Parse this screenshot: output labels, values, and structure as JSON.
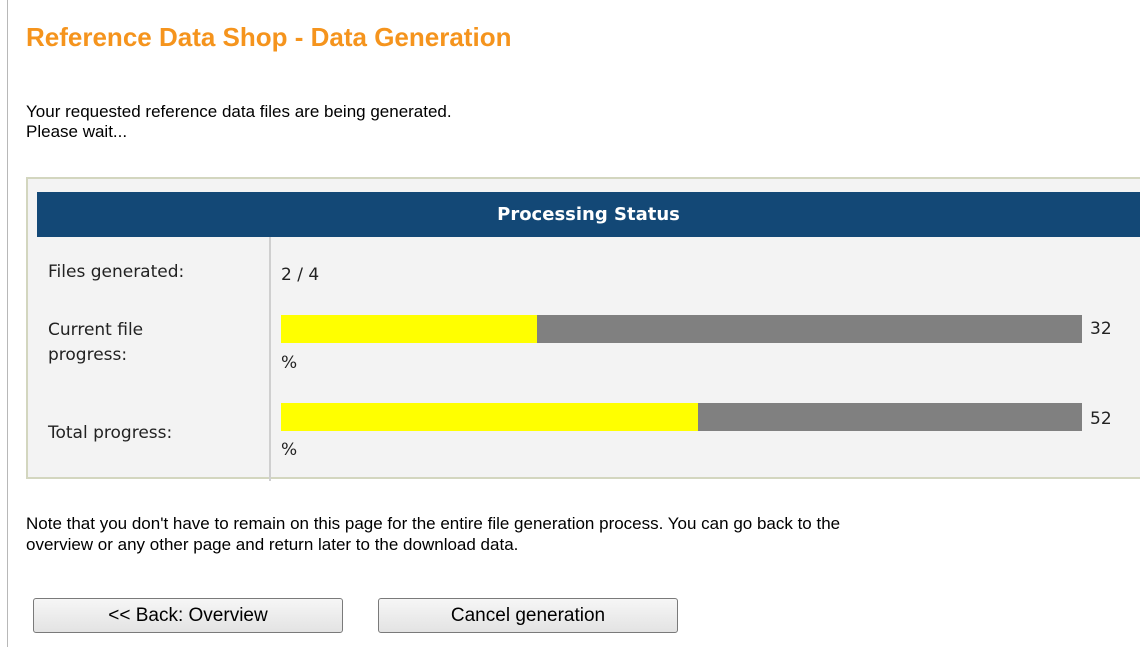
{
  "page": {
    "title": "Reference Data Shop - Data Generation",
    "intro_line1": "Your requested reference data files are being generated.",
    "intro_line2": "Please wait..."
  },
  "status": {
    "header": "Processing Status",
    "files_generated_label": "Files generated:",
    "files_generated_value": "2 / 4",
    "current_file_label_line1": "Current file",
    "current_file_label_line2": "progress:",
    "current_file_percent": "32",
    "current_file_fraction": 0.32,
    "total_label": "Total progress:",
    "total_percent": "52",
    "total_fraction": 0.52,
    "percent_unit": "%"
  },
  "note": {
    "line1": "Note that you don't have to remain on this page for the entire file generation process. You can go back to the",
    "line2": "overview or any other page and return later to the download data."
  },
  "buttons": {
    "back_label": "<< Back: Overview",
    "cancel_label": "Cancel generation"
  },
  "colors": {
    "title": "#f5941d",
    "header_bg": "#134876",
    "progress_fill": "#ffff00",
    "progress_track": "#808080"
  }
}
